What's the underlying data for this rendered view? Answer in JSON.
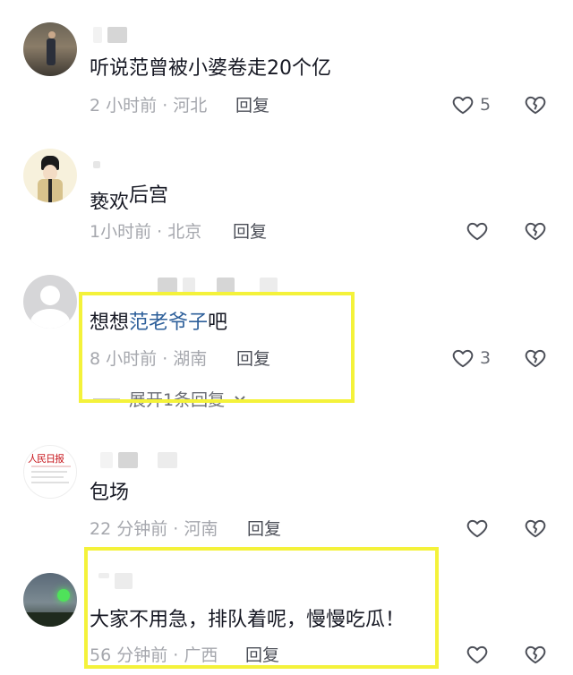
{
  "comments": [
    {
      "text": "听说范曾被小婆卷走20个亿",
      "time": "2 小时前",
      "location": "河北",
      "reply": "回复",
      "likes": "5"
    },
    {
      "text": "后宫",
      "text_prefix": "亵欢",
      "time": "1小时前",
      "location": "北京",
      "reply": "回复",
      "likes": ""
    },
    {
      "text_before": "想想",
      "text_link": "范老爷子",
      "text_after": "吧",
      "time": "8 小时前",
      "location": "湖南",
      "reply": "回复",
      "likes": "3",
      "expand": "展开1条回复"
    },
    {
      "text": "包场",
      "time": "22 分钟前",
      "location": "河南",
      "reply": "回复",
      "likes": ""
    },
    {
      "text": "大家不用急，排队着呢，慢慢吃瓜！",
      "time": "56 分钟前",
      "location": "广西",
      "reply": "回复",
      "likes": ""
    }
  ],
  "meta_separator": "·",
  "avatar4_brand": "人民日报",
  "colors": {
    "highlight_box": "#f4f23a",
    "link": "#2d5f9a",
    "meta": "#a5a7ad"
  }
}
